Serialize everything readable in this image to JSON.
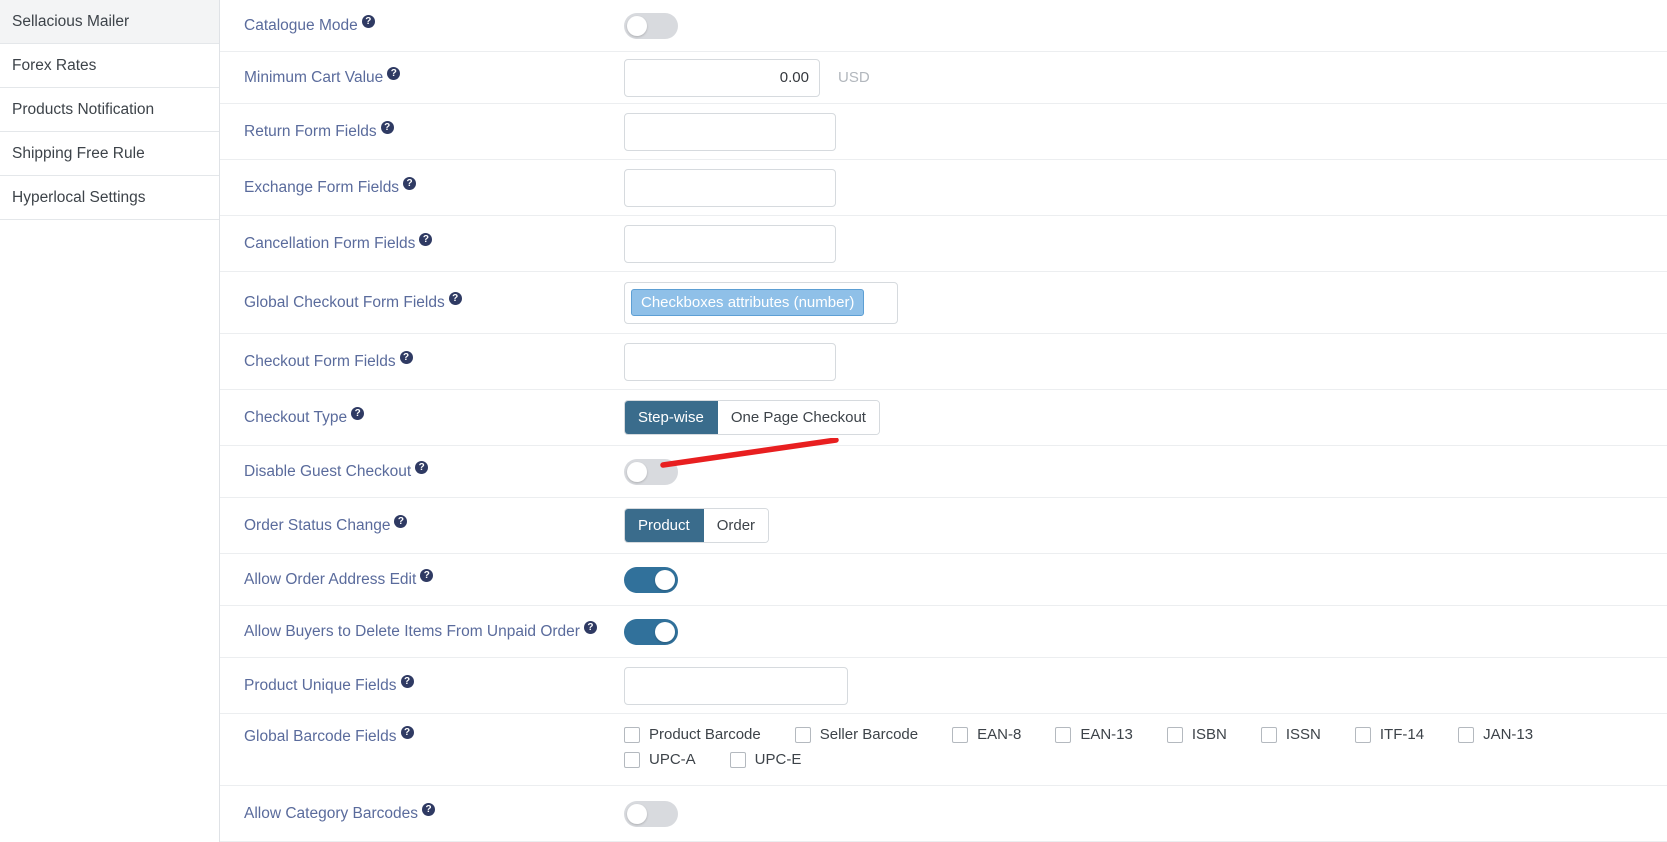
{
  "sidebar": {
    "items": [
      {
        "label": "Sellacious Mailer",
        "active": true
      },
      {
        "label": "Forex Rates",
        "active": false
      },
      {
        "label": "Products Notification",
        "active": false
      },
      {
        "label": "Shipping Free Rule",
        "active": false
      },
      {
        "label": "Hyperlocal Settings",
        "active": false
      }
    ]
  },
  "help_glyph": "?",
  "colors": {
    "label": "#5a6b9c",
    "toggle_on": "#31719b",
    "toggle_off": "#d8dade",
    "btn_active": "#3a6c8c",
    "chip_bg": "#8fc0e8",
    "chip_border": "#5d9fd4",
    "annotation": "#e81f20"
  },
  "settings": {
    "catalogue_mode": {
      "label": "Catalogue Mode",
      "toggle": "off"
    },
    "minimum_cart_value": {
      "label": "Minimum Cart Value",
      "value": "0.00",
      "placeholder": "",
      "unit": "USD"
    },
    "return_form_fields": {
      "label": "Return Form Fields",
      "value": "",
      "placeholder": ""
    },
    "exchange_form_fields": {
      "label": "Exchange Form Fields",
      "value": "",
      "placeholder": ""
    },
    "cancellation_form_fields": {
      "label": "Cancellation Form Fields",
      "value": "",
      "placeholder": ""
    },
    "global_checkout_form_fields": {
      "label": "Global Checkout Form Fields",
      "chips": [
        "Checkboxes attributes (number)"
      ]
    },
    "checkout_form_fields": {
      "label": "Checkout Form Fields",
      "value": "",
      "placeholder": ""
    },
    "checkout_type": {
      "label": "Checkout Type",
      "options": [
        {
          "label": "Step-wise",
          "active": true
        },
        {
          "label": "One Page Checkout",
          "active": false
        }
      ]
    },
    "disable_guest_checkout": {
      "label": "Disable Guest Checkout",
      "toggle": "off"
    },
    "order_status_change": {
      "label": "Order Status Change",
      "options": [
        {
          "label": "Product",
          "active": true
        },
        {
          "label": "Order",
          "active": false
        }
      ]
    },
    "allow_order_address_edit": {
      "label": "Allow Order Address Edit",
      "toggle": "on"
    },
    "allow_buyers_delete_items": {
      "label": "Allow Buyers to Delete Items From Unpaid Order",
      "toggle": "on"
    },
    "product_unique_fields": {
      "label": "Product Unique Fields",
      "value": "",
      "placeholder": ""
    },
    "global_barcode_fields": {
      "label": "Global Barcode Fields",
      "options": [
        {
          "label": "Product Barcode",
          "checked": false
        },
        {
          "label": "Seller Barcode",
          "checked": false
        },
        {
          "label": "EAN-8",
          "checked": false
        },
        {
          "label": "EAN-13",
          "checked": false
        },
        {
          "label": "ISBN",
          "checked": false
        },
        {
          "label": "ISSN",
          "checked": false
        },
        {
          "label": "ITF-14",
          "checked": false
        },
        {
          "label": "JAN-13",
          "checked": false
        },
        {
          "label": "UPC-A",
          "checked": false
        },
        {
          "label": "UPC-E",
          "checked": false
        }
      ]
    },
    "allow_category_barcodes": {
      "label": "Allow Category Barcodes",
      "toggle": "off"
    }
  }
}
